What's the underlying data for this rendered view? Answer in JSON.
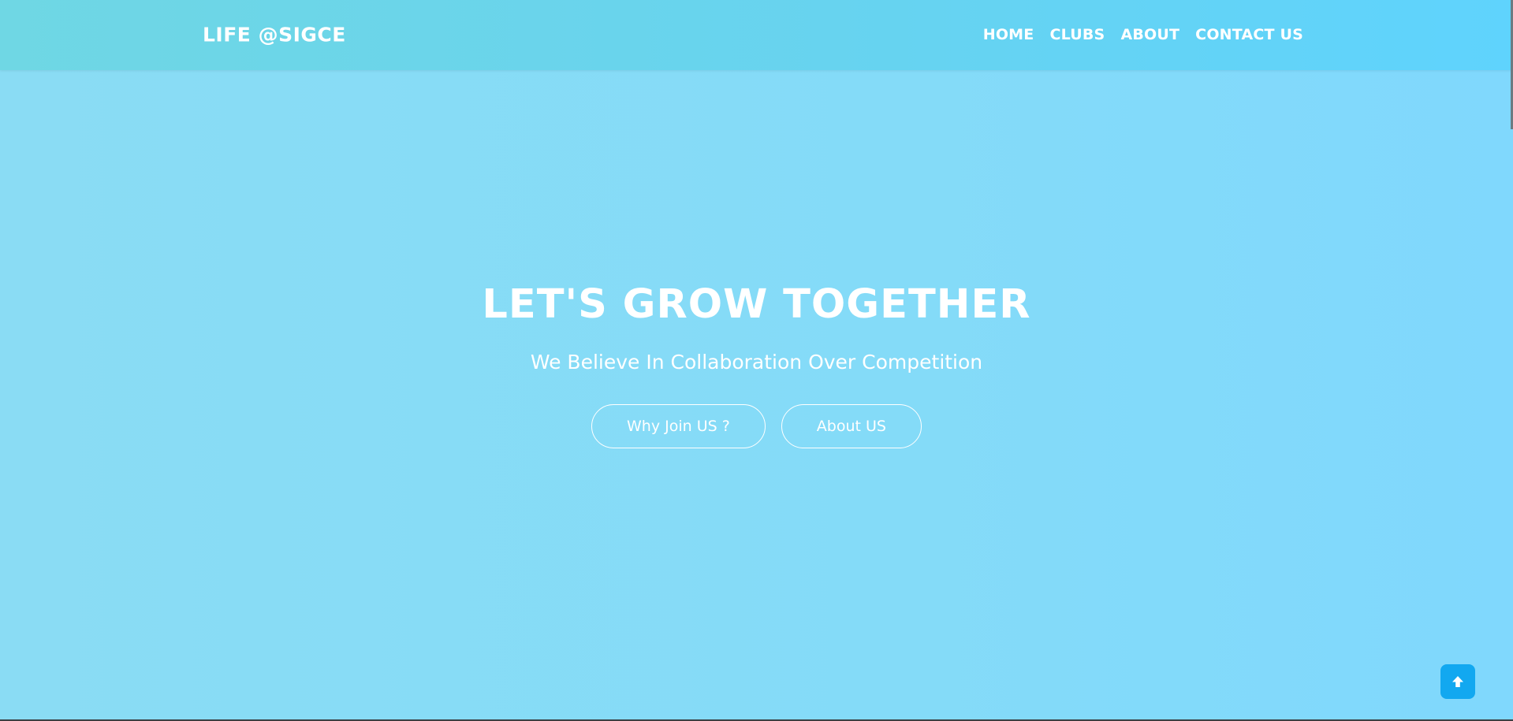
{
  "navbar": {
    "brand": "LIFE @SIGCE",
    "links": [
      {
        "label": "HOME"
      },
      {
        "label": "CLUBS"
      },
      {
        "label": "ABOUT"
      },
      {
        "label": "CONTACT US"
      }
    ]
  },
  "hero": {
    "title": "LET'S GROW TOGETHER",
    "subtitle": "We Believe In Collaboration Over Competition",
    "buttons": [
      {
        "label": "Why Join US ?"
      },
      {
        "label": "About US"
      }
    ]
  },
  "back_to_top": {
    "icon": "arrow-up-icon"
  },
  "colors": {
    "navbar_start": "#6fd7e4",
    "navbar_end": "#5fd3fd",
    "background": "#85dbf8",
    "accent_button": "#12a8f0",
    "text": "#ffffff"
  }
}
